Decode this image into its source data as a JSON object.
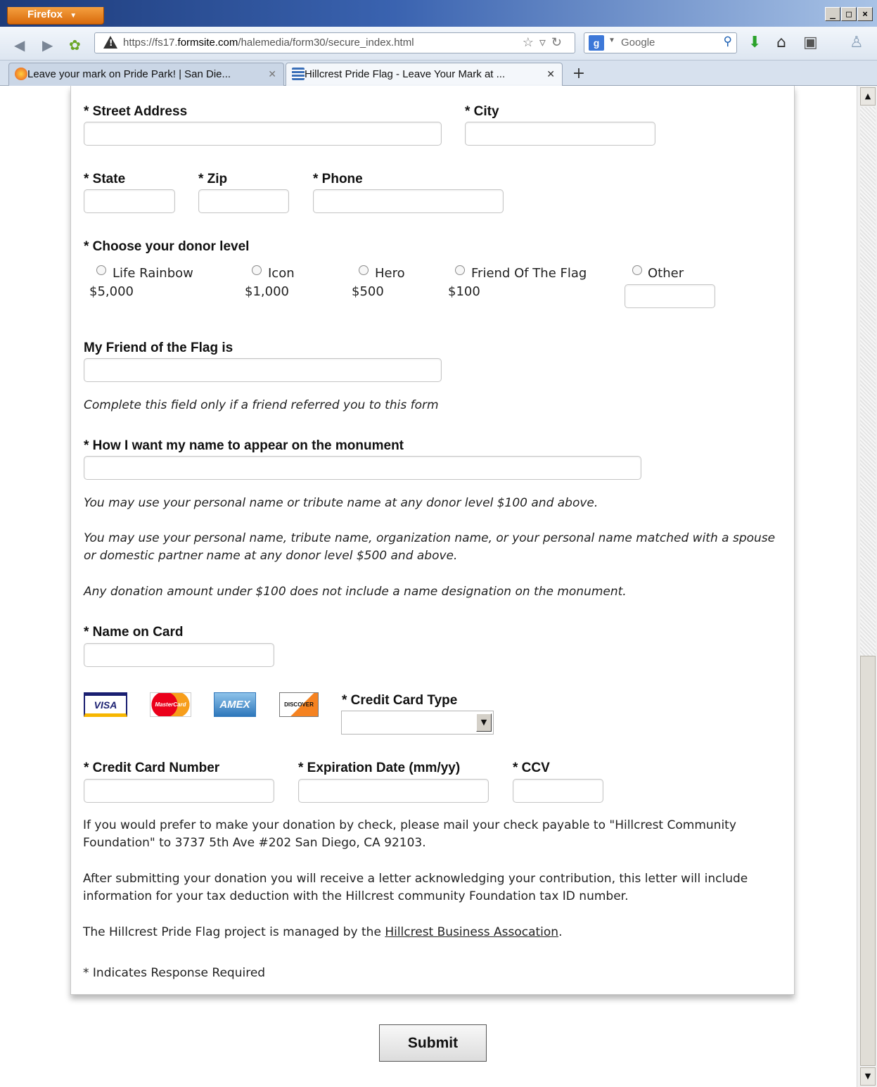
{
  "browser": {
    "app_button": "Firefox",
    "url_host_prefix": "https://fs17.",
    "url_host_bold": "formsite.com",
    "url_path": "/halemedia/form30/secure_index.html",
    "search_engine": "Google",
    "tabs": [
      {
        "title": "Leave your mark on Pride Park! | San Die..."
      },
      {
        "title": "Hillcrest Pride Flag - Leave Your Mark at ..."
      }
    ]
  },
  "form": {
    "street_address_label": "* Street Address",
    "city_label": "* City",
    "state_label": "* State",
    "zip_label": "* Zip",
    "phone_label": "* Phone",
    "donor_level_label": "* Choose your donor level",
    "donor_levels": [
      {
        "name": "Life Rainbow",
        "amount": "$5,000"
      },
      {
        "name": "Icon",
        "amount": "$1,000"
      },
      {
        "name": "Hero",
        "amount": "$500"
      },
      {
        "name": "Friend Of The Flag",
        "amount": "$100"
      },
      {
        "name": "Other",
        "amount": ""
      }
    ],
    "friend_label": "My Friend of the Flag is",
    "friend_note": "Complete this field only if a friend referred you to this form",
    "monument_label": "* How I want my name to appear on the monument",
    "monument_notes": [
      "You may use your personal name or tribute name at any donor level $100 and above.",
      "You may use your personal name, tribute name, organization name, or your personal name matched with a spouse",
      "or domestic partner name at any donor level $500 and above.",
      "Any donation amount under $100 does not include a name designation on the monument."
    ],
    "name_on_card_label": "* Name on Card",
    "card_logos": [
      "VISA",
      "MasterCard",
      "AMEX",
      "DISCOVER"
    ],
    "card_type_label": "* Credit Card Type",
    "card_type_value": "",
    "card_number_label": "* Credit Card Number",
    "expiration_label": "* Expiration Date (mm/yy)",
    "ccv_label": "* CCV",
    "check_info_1": "If you would prefer to make your donation by check, please mail your check payable to \"Hillcrest Community",
    "check_info_2": "Foundation\" to 3737 5th Ave #202  San Diego, CA 92103.",
    "ack_info_1": "After submitting your donation you will receive a letter acknowledging your contribution, this letter will include",
    "ack_info_2": "information for your tax deduction with the Hillcrest community Foundation tax ID number.",
    "managed_prefix": "The Hillcrest Pride Flag project is managed by the ",
    "managed_link": "Hillcrest Business Assocation",
    "managed_suffix": ".",
    "required_note": "* Indicates Response Required",
    "submit_label": "Submit"
  },
  "colors": {
    "firefox_orange": "#e37d1e",
    "visa_blue": "#1a1f71",
    "mastercard_red": "#eb001b",
    "amex_blue": "#2e77bb",
    "discover_orange": "#f58220"
  }
}
